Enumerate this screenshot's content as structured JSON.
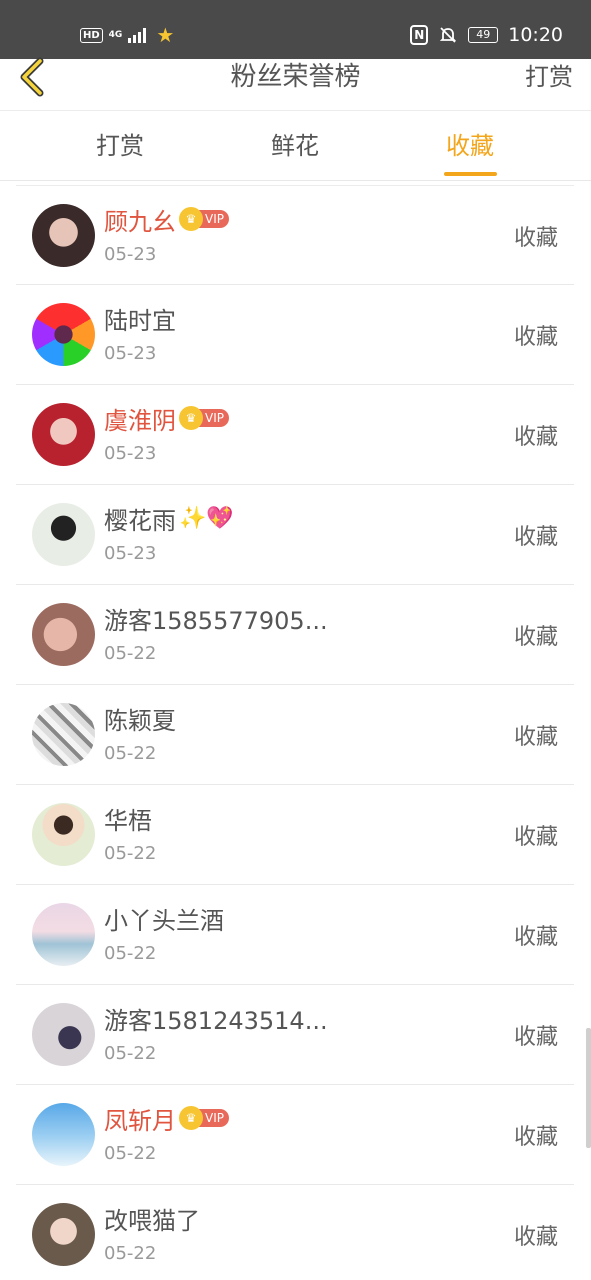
{
  "status_bar": {
    "hd": "HD",
    "network": "4G",
    "battery": "49",
    "time": "10:20",
    "nfc": "N"
  },
  "header": {
    "title": "粉丝荣誉榜",
    "action": "打赏"
  },
  "tabs": [
    {
      "label": "打赏",
      "active": false
    },
    {
      "label": "鲜花",
      "active": false
    },
    {
      "label": "收藏",
      "active": true
    }
  ],
  "accent_color": "#f3a61c",
  "vip_badge_text": "VIP",
  "list": [
    {
      "name": "顾九幺",
      "vip": true,
      "date": "05-23",
      "action": "收藏"
    },
    {
      "name": "陆时宜",
      "vip": false,
      "date": "05-23",
      "action": "收藏"
    },
    {
      "name": "虞淮阴",
      "vip": true,
      "date": "05-23",
      "action": "收藏"
    },
    {
      "name": "樱花雨",
      "vip": false,
      "emoji": "✨💖",
      "date": "05-23",
      "action": "收藏"
    },
    {
      "name": "游客1585577905...",
      "vip": false,
      "date": "05-22",
      "action": "收藏"
    },
    {
      "name": "陈颖夏",
      "vip": false,
      "date": "05-22",
      "action": "收藏"
    },
    {
      "name": "华梧",
      "vip": false,
      "date": "05-22",
      "action": "收藏"
    },
    {
      "name": "小丫头兰酒",
      "vip": false,
      "date": "05-22",
      "action": "收藏"
    },
    {
      "name": "游客1581243514...",
      "vip": false,
      "date": "05-22",
      "action": "收藏"
    },
    {
      "name": "凤斩月",
      "vip": true,
      "date": "05-22",
      "action": "收藏"
    },
    {
      "name": "改喂猫了",
      "vip": false,
      "date": "05-22",
      "action": "收藏"
    }
  ]
}
